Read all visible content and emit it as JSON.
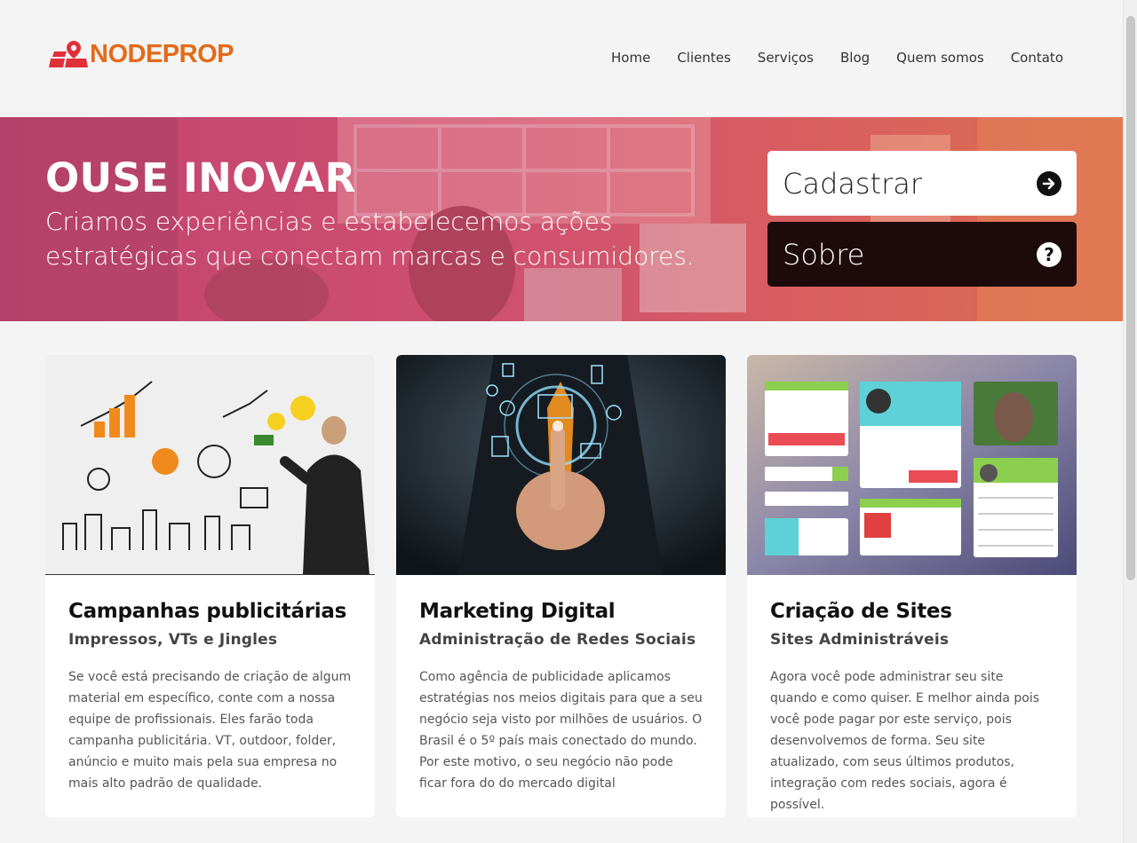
{
  "brand": {
    "name": "NODEPROP",
    "color": "#e36b1a"
  },
  "nav": {
    "items": [
      "Home",
      "Clientes",
      "Serviços",
      "Blog",
      "Quem somos",
      "Contato"
    ]
  },
  "hero": {
    "title": "OUSE INOVAR",
    "subtitle": "Criamos experiências e estabelecemos ações estratégicas que conectam marcas e consumidores.",
    "buttons": {
      "cadastrar": {
        "label": "Cadastrar",
        "icon": "arrow-right-circle-icon"
      },
      "sobre": {
        "label": "Sobre",
        "icon": "question-circle-icon"
      }
    }
  },
  "cards": [
    {
      "title": "Campanhas publicitárias",
      "subtitle": "Impressos, VTs e Jingles",
      "text": "Se você está precisando de criação de algum material em específico, conte com a nossa equipe de profissionais. Eles farão toda campanha publicitária. VT, outdoor, folder, anúncio e muito mais pela sua empresa no mais alto padrão de qualidade."
    },
    {
      "title": "Marketing Digital",
      "subtitle": "Administração de Redes Sociais",
      "text": "Como agência de publicidade aplicamos estratégias nos meios digitais para que a seu negócio seja visto por milhões de usuários. O Brasil é o 5º país mais conectado do mundo. Por este motivo, o seu negócio não pode ficar fora do do mercado digital"
    },
    {
      "title": "Criação de Sites",
      "subtitle": "Sites Administráveis",
      "text": "Agora você pode administrar seu site quando e como quiser. E melhor ainda pois você pode pagar por este serviço, pois desenvolvemos de forma. Seu site atualizado, com seus últimos produtos, integração com redes sociais, agora é possível."
    }
  ],
  "colors": {
    "hero_gradient_start": "#c1436f",
    "hero_gradient_end": "#dc6f4e",
    "sobre_button": "#1d0a0a"
  }
}
